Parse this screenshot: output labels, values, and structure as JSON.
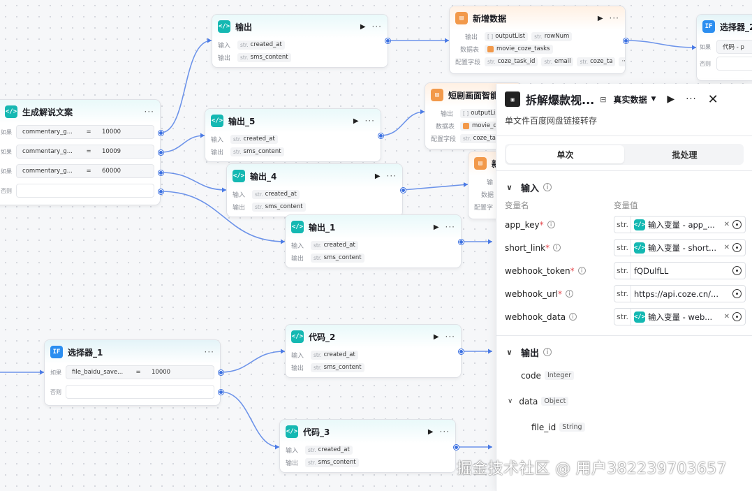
{
  "nodes": {
    "output_top": {
      "title": "输出",
      "in_label": "输入",
      "out_label": "输出",
      "in_field": "created_at",
      "out_field": "sms_content"
    },
    "add_data": {
      "title": "新增数据",
      "r1_label": "输出",
      "r1a": "outputList",
      "r1b": "rowNum",
      "r2_label": "数据表",
      "r2a": "movie_coze_tasks",
      "r3_label": "配置字段",
      "r3a": "coze_task_id",
      "r3b": "email",
      "r3c": "coze_ta"
    },
    "selector2": {
      "title": "选择器_2",
      "r1_label": "如果",
      "r1a": "代码 - p",
      "r2_label": "否则"
    },
    "gen_copy": {
      "title": "生成解说文案",
      "c1_label": "如果",
      "c1_var": "commentary_g...",
      "c1_val": "10000",
      "c2_label": "如果",
      "c2_var": "commentary_g...",
      "c2_val": "10009",
      "c3_label": "如果",
      "c3_var": "commentary_g...",
      "c3_val": "60000",
      "c4_label": "否则"
    },
    "output5": {
      "title": "输出_5",
      "in_field": "created_at",
      "out_field": "sms_content"
    },
    "short_drama": {
      "title": "短剧画面智能",
      "r1a": "outputList",
      "r2a": "movie_c",
      "r3a": "coze_task"
    },
    "output4": {
      "title": "输出_4",
      "in_field": "created_at",
      "out_field": "sms_content"
    },
    "hidden_node": {
      "title": "新",
      "r1_label": "输",
      "r2_label": "数据",
      "r3_label": "配置字"
    },
    "output1": {
      "title": "输出_1",
      "in_field": "created_at",
      "out_field": "sms_content"
    },
    "code2": {
      "title": "代码_2",
      "in_field": "created_at",
      "out_field": "sms_content"
    },
    "selector1": {
      "title": "选择器_1",
      "c1_label": "如果",
      "c1_var": "file_baidu_save...",
      "c1_val": "10000",
      "c2_label": "否则"
    },
    "code3": {
      "title": "代码_3",
      "in_field": "created_at",
      "out_field": "sms_content"
    }
  },
  "labels": {
    "in": "输入",
    "out": "输出",
    "str": "str.",
    "eq": "=",
    "play": "▶",
    "more": "···"
  },
  "panel": {
    "title": "拆解爆款视...",
    "mode": "真实数据",
    "subtitle": "单文件百度网盘链接转存",
    "tabs": [
      "单次",
      "批处理"
    ],
    "input_section": "输入",
    "col_name": "变量名",
    "col_value": "变量值",
    "vars": [
      {
        "name": "app_key",
        "required": "*",
        "type": "str.",
        "value": "输入变量 - app_...",
        "ref": true
      },
      {
        "name": "short_link",
        "required": "*",
        "type": "str.",
        "value": "输入变量 - short...",
        "ref": true
      },
      {
        "name": "webhook_token",
        "required": "*",
        "type": "str.",
        "value": "fQDulfLL",
        "ref": false
      },
      {
        "name": "webhook_url",
        "required": "*",
        "type": "str.",
        "value": "https://api.coze.cn/...",
        "ref": false
      },
      {
        "name": "webhook_data",
        "required": "",
        "type": "str.",
        "value": "输入变量 - web...",
        "ref": true
      }
    ],
    "output_section": "输出",
    "outputs": [
      {
        "name": "code",
        "type": "Integer"
      },
      {
        "name": "data",
        "type": "Object"
      },
      {
        "name": "file_id",
        "type": "String"
      }
    ]
  },
  "watermark": "掘金技术社区 @ 用户3822397036 57",
  "watermark_text": "掘金技术社区 @ 用户382239703657",
  "colors": {
    "edge": "#4b7be6",
    "teal": "#14b8b2",
    "orange": "#f2994a",
    "required": "#e5484d"
  }
}
